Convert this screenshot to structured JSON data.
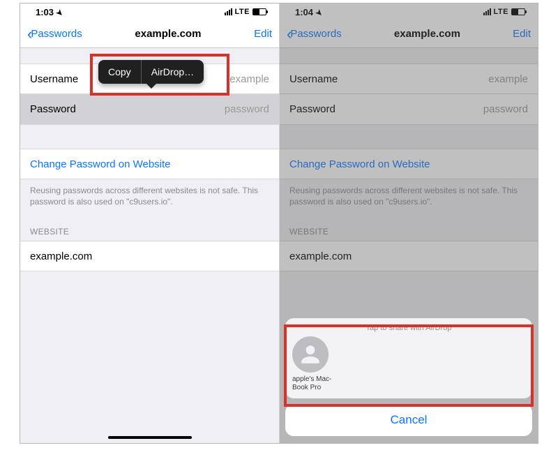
{
  "left": {
    "status": {
      "time": "1:03",
      "carrier": "LTE"
    },
    "nav": {
      "back": "Passwords",
      "title": "example.com",
      "edit": "Edit"
    },
    "rows": {
      "username_label": "Username",
      "username_value": "example",
      "password_label": "Password",
      "password_value": "password",
      "change_link": "Change Password on Website"
    },
    "note": "Reusing passwords across different websites is not safe. This password is also used on \"c9users.io\".",
    "section_header": "WEBSITE",
    "website_value": "example.com",
    "popover": {
      "copy": "Copy",
      "airdrop": "AirDrop…"
    }
  },
  "right": {
    "status": {
      "time": "1:04",
      "carrier": "LTE"
    },
    "nav": {
      "back": "Passwords",
      "title": "example.com",
      "edit": "Edit"
    },
    "rows": {
      "username_label": "Username",
      "username_value": "example",
      "password_label": "Password",
      "password_value": "password",
      "change_link": "Change Password on Website"
    },
    "note": "Reusing passwords across different websites is not safe. This password is also used on \"c9users.io\".",
    "section_header": "WEBSITE",
    "website_value": "example.com",
    "sheet": {
      "title": "Tap to share with AirDrop",
      "contact": "apple's Mac-Book Pro",
      "cancel": "Cancel"
    }
  }
}
